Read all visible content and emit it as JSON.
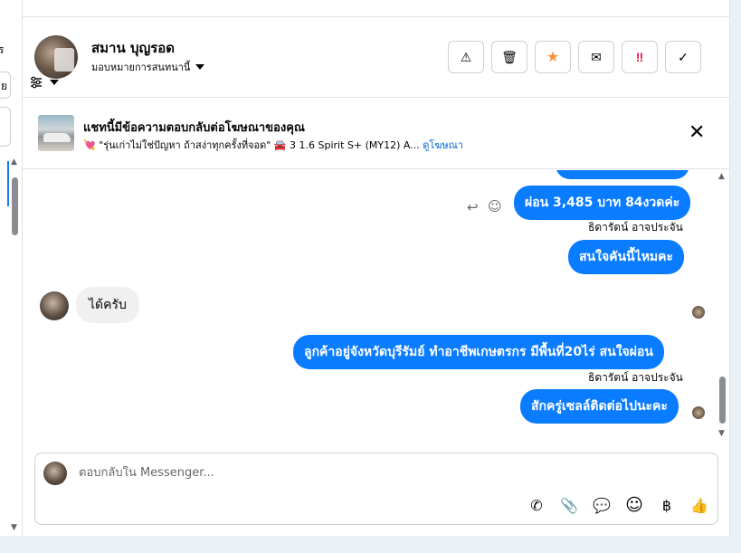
{
  "left_panel": {
    "text_top": "ร",
    "text_mid": "ย"
  },
  "contact": {
    "name": "สมาน บุญรอด",
    "assign_label": "มอบหมายการสนทนานี้"
  },
  "header_actions": [
    {
      "icon": "warning-icon",
      "glyph": "⚠"
    },
    {
      "icon": "trash-icon",
      "glyph": "🗑"
    },
    {
      "icon": "star-icon",
      "glyph": "★",
      "color": "#f7923a"
    },
    {
      "icon": "mail-icon",
      "glyph": "✉"
    },
    {
      "icon": "spam-icon",
      "glyph": "‼",
      "color": "#e41e3f"
    },
    {
      "icon": "check-icon",
      "glyph": "✓"
    }
  ],
  "ad": {
    "title": "แชทนี้มีข้อความตอบกลับต่อโฆษณาของคุณ",
    "description": "💘 \"รุ่นเก่าไม่ใช่ปัญหา ถ้าสง่าทุกครั้งที่จอด\" 🚘 3 1.6 Spirit S+ (MY12) A...",
    "view_link": "ดูโฆษณา",
    "close_glyph": "✕"
  },
  "messages": {
    "m1": "ผ่อน 3,485 บาท 84งวดค่ะ",
    "sender1": "ธิดารัตน์ อาจประจัน",
    "m2": "สนใจคันนี้ไหมคะ",
    "m3": "ได้ครับ",
    "m4": "ลูกค้าอยู่จังหวัดบุรีรัมย์ ทำอาชีพเกษตรกร มีพื้นที่20ไร่ สนใจผ่อน",
    "sender2": "ธิดารัตน์ อาจประจัน",
    "m5": "สักครู่เซลล์ติดต่อไปนะคะ"
  },
  "composer": {
    "placeholder": "ตอบกลับใน Messenger..."
  },
  "composer_tools": [
    {
      "icon": "phone-icon",
      "glyph": "✆"
    },
    {
      "icon": "attachment-icon",
      "glyph": "📎"
    },
    {
      "icon": "saved-reply-icon",
      "glyph": "💬"
    },
    {
      "icon": "emoji-icon",
      "glyph": "☺"
    },
    {
      "icon": "baht-icon",
      "glyph": "฿"
    },
    {
      "icon": "thumbs-up-icon",
      "glyph": "👍"
    }
  ],
  "colors": {
    "accent": "#0a7cff",
    "link": "#0064d1"
  }
}
